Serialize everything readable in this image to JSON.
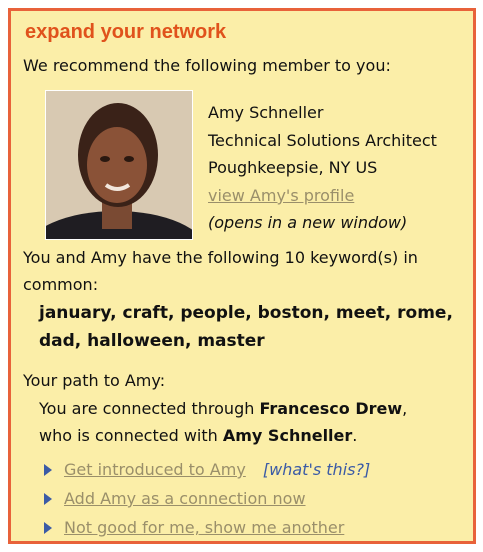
{
  "panel": {
    "title": "expand your network",
    "intro": "We recommend the following member to you:",
    "member": {
      "name": "Amy Schneller",
      "job_title": "Technical Solutions Architect",
      "location": "Poughkeepsie, NY US",
      "profile_link": "view Amy's profile",
      "opens_note": "(opens in a new window)"
    },
    "keywords_intro_line1": "You and Amy have the following 10 keyword(s) in",
    "keywords_intro_line2": "common:",
    "keywords_line1": "january, craft, people, boston, meet, rome,",
    "keywords_line2": "dad, halloween, master",
    "path": {
      "heading": "Your path to Amy:",
      "line1_prefix": "You are connected through ",
      "connector": "Francesco Drew",
      "line1_suffix": ",",
      "line2_prefix": "who is connected with ",
      "target": "Amy Schneller",
      "line2_suffix": "."
    },
    "actions": {
      "introduce": "Get introduced to Amy",
      "whats_this": "[what's this?]",
      "add": "Add Amy as a connection now",
      "not_good": "Not good for me, show me another"
    }
  },
  "colors": {
    "border": "#e8623a",
    "background": "#fbeea8",
    "title": "#e0521c",
    "link": "#9a8f6a",
    "arrow": "#3b5ba6"
  },
  "icons": [
    "member-photo",
    "arrow-right-icon"
  ]
}
